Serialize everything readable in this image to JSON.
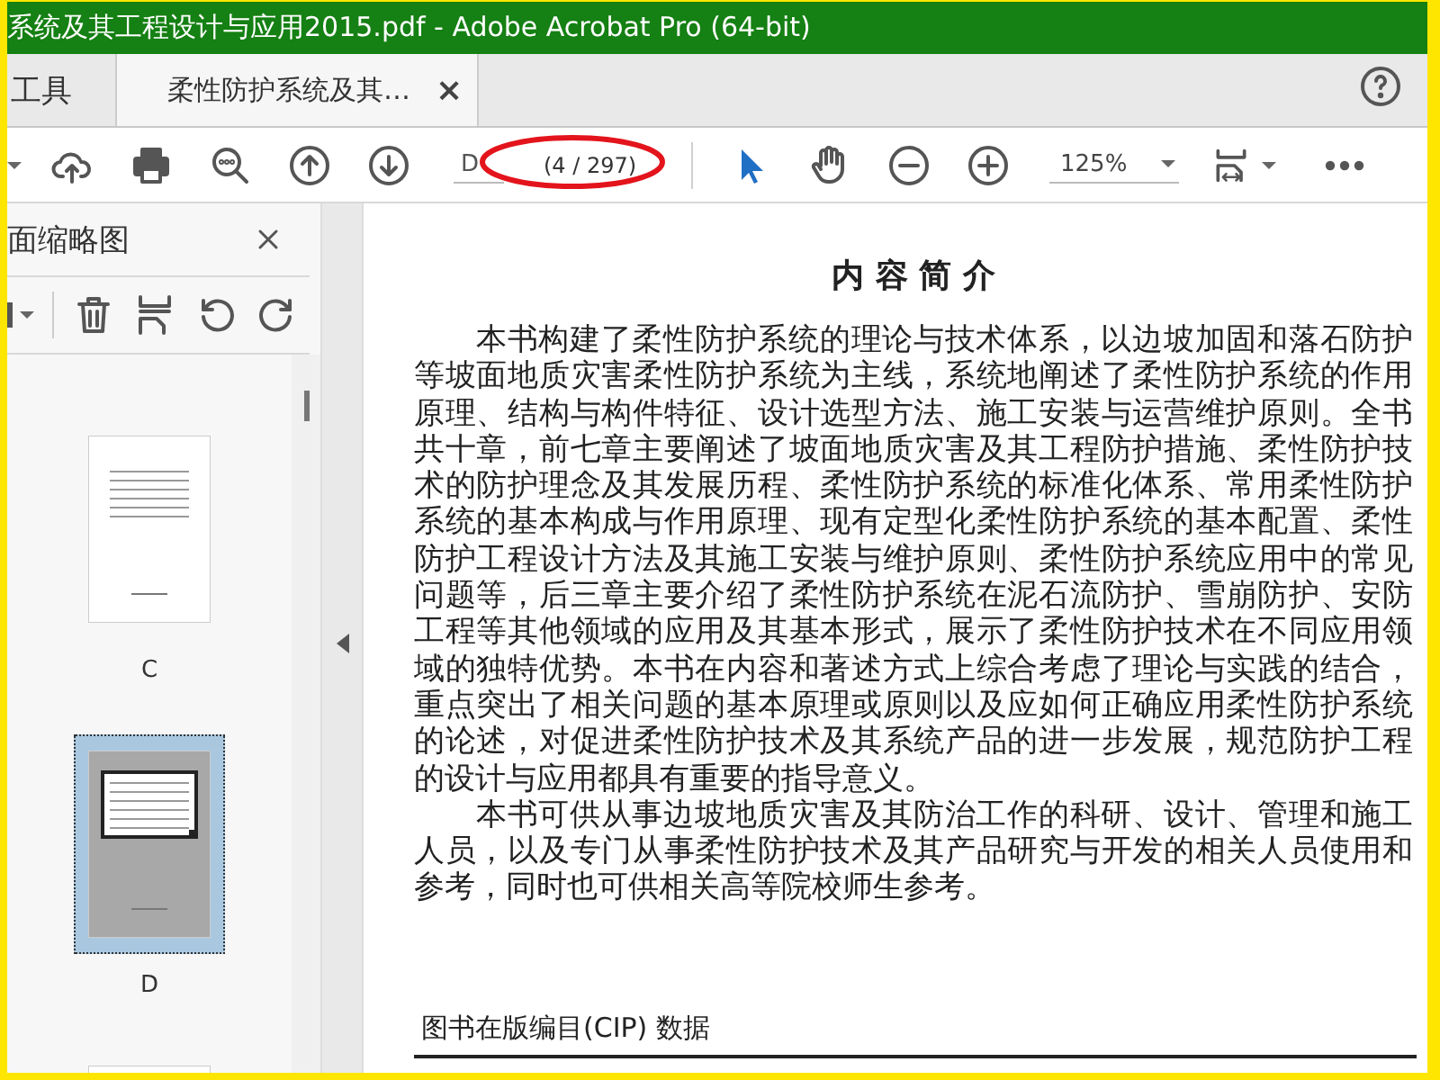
{
  "window": {
    "title": "系统及其工程设计与应用2015.pdf - Adobe Acrobat Pro (64-bit)"
  },
  "tabs": [
    {
      "label": "工具",
      "selected": false
    },
    {
      "label": "柔性防护系统及其…",
      "selected": true,
      "close": "×"
    }
  ],
  "toolbar": {
    "page_field": {
      "value": "D"
    },
    "page_count": "(4 / 297)",
    "zoom_field": {
      "value": "125%"
    }
  },
  "annotation": {
    "kind": "ellipse"
  },
  "thumbnails_pane": {
    "title": "面缩略图",
    "thumbnails": [
      {
        "label": "C",
        "selected": false
      },
      {
        "label": "D",
        "selected": true
      },
      {
        "selected": false
      }
    ]
  },
  "document": {
    "heading": "内 容 简 介",
    "paragraphs": [
      "本书构建了柔性防护系统的理论与技术体系，以边坡加固和落石防护等坡面地质灾害柔性防护系统为主线，系统地阐述了柔性防护系统的作用原理、结构与构件特征、设计选型方法、施工安装与运营维护原则。全书共十章，前七章主要阐述了坡面地质灾害及其工程防护措施、柔性防护技术的防护理念及其发展历程、柔性防护系统的标准化体系、常用柔性防护系统的基本构成与作用原理、现有定型化柔性防护系统的基本配置、柔性防护工程设计方法及其施工安装与维护原则、柔性防护系统应用中的常见问题等，后三章主要介绍了柔性防护系统在泥石流防护、雪崩防护、安防工程等其他领域的应用及其基本形式，展示了柔性防护技术在不同应用领域的独特优势。本书在内容和著述方式上综合考虑了理论与实践的结合，重点突出了相关问题的基本原理或原则以及应如何正确应用柔性防护系统的论述，对促进柔性防护技术及其系统产品的进一步发展，规范防护工程的设计与应用都具有重要的指导意义。",
      "本书可供从事边坡地质灾害及其防治工作的科研、设计、管理和施工人员，以及专门从事柔性防护技术及其产品研究与开发的相关人员使用和参考，同时也可供相关高等院校师生参考。"
    ],
    "cip_heading": "图书在版编目(CIP) 数据"
  }
}
